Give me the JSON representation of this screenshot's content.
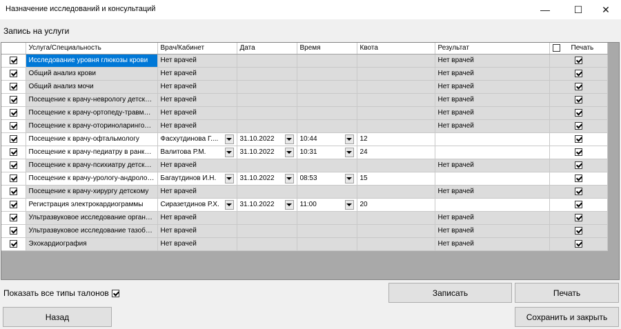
{
  "window": {
    "title": "Назначение исследований и консультаций",
    "minimize_glyph": "—",
    "maximize_glyph": "☐",
    "close_glyph": "✕"
  },
  "section_label": "Запись на услуги",
  "grid": {
    "columns": {
      "service": "Услуга/Специальность",
      "doctor": "Врач/Кабинет",
      "date": "Дата",
      "time": "Время",
      "quota": "Квота",
      "result": "Результат",
      "print": "Печать"
    },
    "print_all_checked": false,
    "rows": [
      {
        "checked": true,
        "service": "Исследование уровня глюкозы крови",
        "doctor": "Нет врачей",
        "date": "",
        "time": "",
        "quota": "",
        "result": "Нет врачей",
        "print": true,
        "active": false,
        "selected": true
      },
      {
        "checked": true,
        "service": "Общий анализ крови",
        "doctor": "Нет врачей",
        "date": "",
        "time": "",
        "quota": "",
        "result": "Нет врачей",
        "print": true,
        "active": false
      },
      {
        "checked": true,
        "service": "Общий анализ мочи",
        "doctor": "Нет врачей",
        "date": "",
        "time": "",
        "quota": "",
        "result": "Нет врачей",
        "print": true,
        "active": false
      },
      {
        "checked": true,
        "service": "Посещение к врачу-неврологу детскому",
        "doctor": "Нет врачей",
        "date": "",
        "time": "",
        "quota": "",
        "result": "Нет врачей",
        "print": true,
        "active": false
      },
      {
        "checked": true,
        "service": "Посещение к врачу-ортопеду-травмат...",
        "doctor": "Нет врачей",
        "date": "",
        "time": "",
        "quota": "",
        "result": "Нет врачей",
        "print": true,
        "active": false
      },
      {
        "checked": true,
        "service": "Посещение к врачу-оториноларингологу",
        "doctor": "Нет врачей",
        "date": "",
        "time": "",
        "quota": "",
        "result": "Нет врачей",
        "print": true,
        "active": false
      },
      {
        "checked": true,
        "service": "Посещение к врачу-офтальмологу",
        "doctor": "Фасхутдинова Г....",
        "date": "31.10.2022",
        "time": "10:44",
        "quota": "12",
        "result": "",
        "print": true,
        "active": true
      },
      {
        "checked": true,
        "service": "Посещение к врачу-педиатру в ранках...",
        "doctor": "Валитова Р.М.",
        "date": "31.10.2022",
        "time": "10:31",
        "quota": "24",
        "result": "",
        "print": true,
        "active": true
      },
      {
        "checked": true,
        "service": "Посещение к врачу-психиатру детскому",
        "doctor": "Нет врачей",
        "date": "",
        "time": "",
        "quota": "",
        "result": "Нет врачей",
        "print": true,
        "active": false
      },
      {
        "checked": true,
        "service": "Посещение к врачу-урологу-андролог...",
        "doctor": "Багаутдинов И.Н.",
        "date": "31.10.2022",
        "time": "08:53",
        "quota": "15",
        "result": "",
        "print": true,
        "active": true
      },
      {
        "checked": true,
        "service": "Посещение к врачу-хирургу детскому",
        "doctor": "Нет врачей",
        "date": "",
        "time": "",
        "quota": "",
        "result": "Нет врачей",
        "print": true,
        "active": false
      },
      {
        "checked": true,
        "service": "Регистрация электрокардиограммы",
        "doctor": "Сиразетдинов Р.Х.",
        "date": "31.10.2022",
        "time": "11:00",
        "quota": "20",
        "result": "",
        "print": true,
        "active": true
      },
      {
        "checked": true,
        "service": "Ультразвуковое исследование органо...",
        "doctor": "Нет врачей",
        "date": "",
        "time": "",
        "quota": "",
        "result": "Нет врачей",
        "print": true,
        "active": false
      },
      {
        "checked": true,
        "service": "Ультразвуковое исследование тазобе...",
        "doctor": "Нет врачей",
        "date": "",
        "time": "",
        "quota": "",
        "result": "Нет врачей",
        "print": true,
        "active": false
      },
      {
        "checked": true,
        "service": "Эхокардиография",
        "doctor": "Нет врачей",
        "date": "",
        "time": "",
        "quota": "",
        "result": "Нет врачей",
        "print": true,
        "active": false
      }
    ]
  },
  "show_all_types": {
    "label": "Показать все типы талонов",
    "checked": true
  },
  "buttons": {
    "record": "Записать",
    "print": "Печать",
    "back": "Назад",
    "save_close": "Сохранить и закрыть"
  },
  "colors": {
    "selection": "#0078d7",
    "grid_background": "#a9a9a9",
    "inactive_row": "#dcdcdc"
  }
}
